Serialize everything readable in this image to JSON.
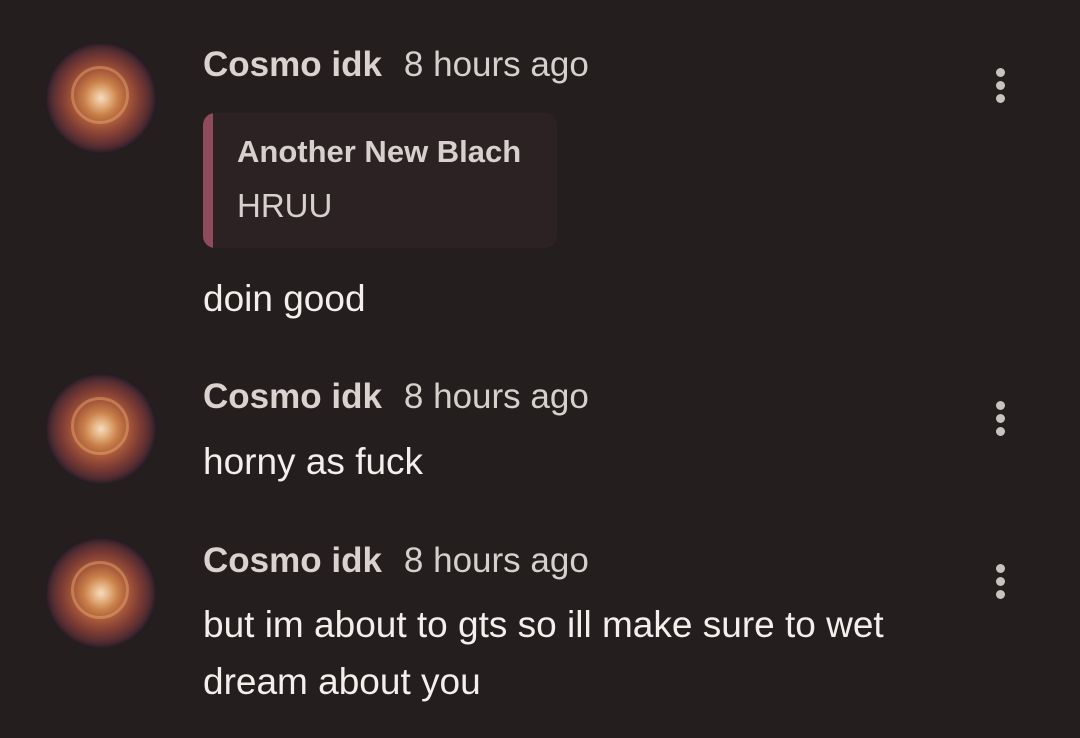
{
  "comments": [
    {
      "author": "Cosmo idk",
      "time": "8 hours ago",
      "reply_to": {
        "author": "Another New Blach",
        "text": "HRUU"
      },
      "text": "doin good"
    },
    {
      "author": "Cosmo idk",
      "time": "8 hours ago",
      "text": "horny as fuck"
    },
    {
      "author": "Cosmo idk",
      "time": "8 hours ago",
      "text": "but im about to gts so ill make sure to wet dream about you"
    }
  ],
  "icons": {
    "more": "more-vertical-icon",
    "avatar": "avatar"
  },
  "colors": {
    "background": "#241e1e",
    "quote_background": "#2c2224",
    "quote_accent": "#8f4a5c",
    "text": "#f3efed",
    "meta_text": "#d6d0cd"
  }
}
